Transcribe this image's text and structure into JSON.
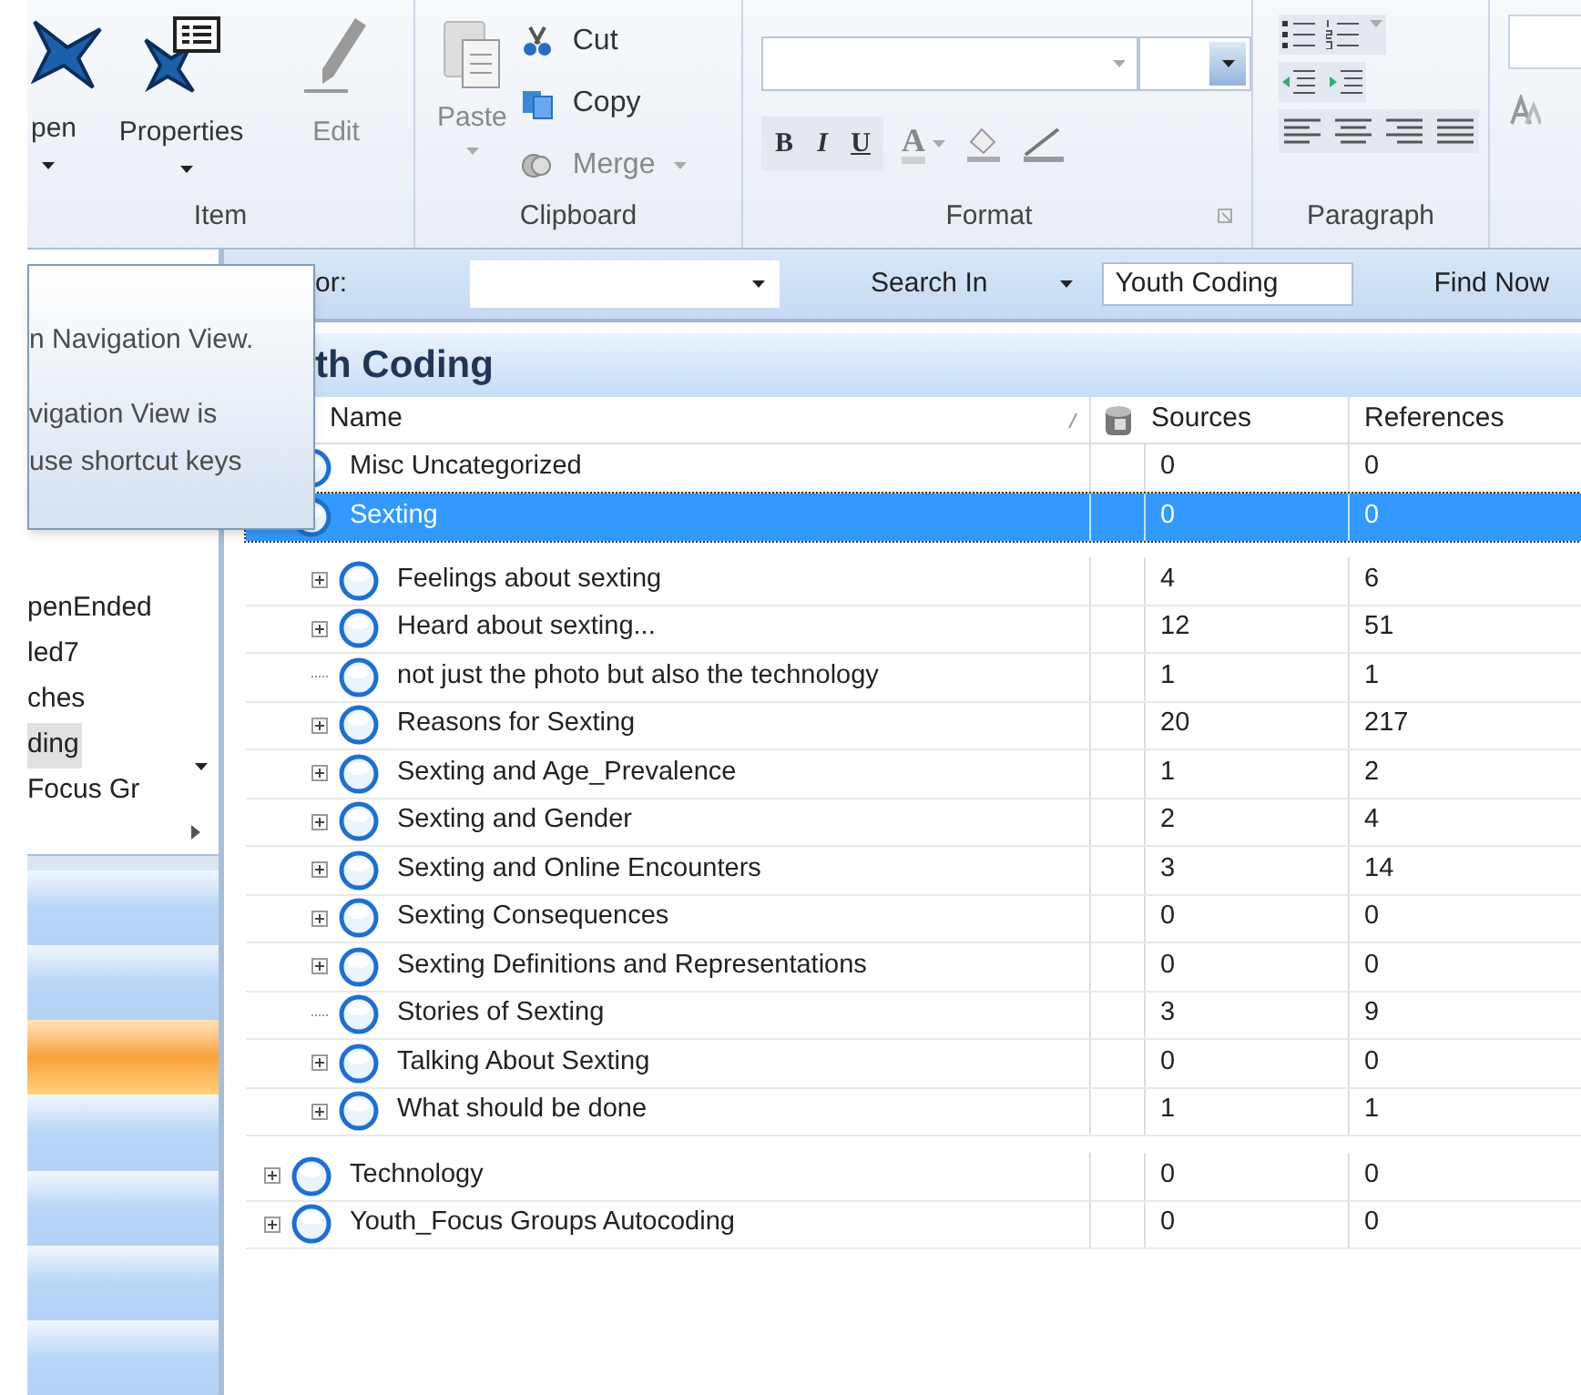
{
  "ribbon": {
    "item_group": {
      "label": "Item",
      "buttons": [
        {
          "label": "pen",
          "kind": "node",
          "dropdown": true,
          "disabled": false
        },
        {
          "label": "Properties",
          "kind": "properties",
          "dropdown": true,
          "disabled": false
        },
        {
          "label": "Edit",
          "kind": "pencil",
          "dropdown": false,
          "disabled": true
        }
      ]
    },
    "clipboard_group": {
      "label": "Clipboard",
      "paste": {
        "label": "Paste",
        "disabled": true
      },
      "small": [
        {
          "label": "Cut",
          "kind": "cut",
          "disabled": false,
          "dropdown": false
        },
        {
          "label": "Copy",
          "kind": "copy",
          "disabled": false,
          "dropdown": false
        },
        {
          "label": "Merge",
          "kind": "merge",
          "disabled": true,
          "dropdown": true
        }
      ]
    },
    "format_group": {
      "label": "Format",
      "style_buttons": [
        {
          "label": "B",
          "kind": "bold"
        },
        {
          "label": "I",
          "kind": "italic"
        },
        {
          "label": "U",
          "kind": "underline"
        },
        {
          "label": "A",
          "kind": "color"
        }
      ]
    },
    "paragraph_group": {
      "label": "Paragraph"
    }
  },
  "search_bar": {
    "label": "or:",
    "search_in": "Search In",
    "scope": "Youth Coding",
    "find_now": "Find Now"
  },
  "navigation": {
    "items": [
      {
        "label": "penEnded",
        "selected": false
      },
      {
        "label": "led7",
        "selected": false
      },
      {
        "label": "ches",
        "selected": false
      },
      {
        "label": "ding",
        "selected": true
      },
      {
        "label": "Focus Gr",
        "selected": false
      }
    ],
    "nav_buttons": [
      {
        "selected": false
      },
      {
        "selected": false
      },
      {
        "selected": true
      },
      {
        "selected": false
      },
      {
        "selected": false
      },
      {
        "selected": false
      },
      {
        "selected": false
      }
    ]
  },
  "tooltip": {
    "lines": [
      "n Navigation View.",
      "vigation View is",
      "use shortcut keys"
    ]
  },
  "panel": {
    "title": "th Coding",
    "columns": {
      "name": "Name",
      "sources": "Sources",
      "references": "References"
    },
    "nodes": [
      {
        "name": "Misc Uncategorized",
        "sources": "0",
        "references": "0",
        "expandable": false,
        "selected": false
      },
      {
        "name": "Sexting",
        "sources": "0",
        "references": "0",
        "expandable": true,
        "selected": true,
        "children": [
          {
            "name": "Feelings about sexting",
            "sources": "4",
            "references": "6",
            "expandable": true,
            "selected": false
          },
          {
            "name": "Heard about sexting...",
            "sources": "12",
            "references": "51",
            "expandable": true,
            "selected": false
          },
          {
            "name": "not just the photo but also the technology",
            "sources": "1",
            "references": "1",
            "expandable": false,
            "selected": false
          },
          {
            "name": "Reasons for Sexting",
            "sources": "20",
            "references": "217",
            "expandable": true,
            "selected": false
          },
          {
            "name": "Sexting and Age_Prevalence",
            "sources": "1",
            "references": "2",
            "expandable": true,
            "selected": false
          },
          {
            "name": "Sexting and Gender",
            "sources": "2",
            "references": "4",
            "expandable": true,
            "selected": false
          },
          {
            "name": "Sexting and Online Encounters",
            "sources": "3",
            "references": "14",
            "expandable": true,
            "selected": false
          },
          {
            "name": "Sexting Consequences",
            "sources": "0",
            "references": "0",
            "expandable": true,
            "selected": false
          },
          {
            "name": "Sexting Definitions and Representations",
            "sources": "0",
            "references": "0",
            "expandable": true,
            "selected": false
          },
          {
            "name": "Stories of Sexting",
            "sources": "3",
            "references": "9",
            "expandable": false,
            "selected": false
          },
          {
            "name": "Talking About Sexting",
            "sources": "0",
            "references": "0",
            "expandable": true,
            "selected": false
          },
          {
            "name": "What should be done",
            "sources": "1",
            "references": "1",
            "expandable": true,
            "selected": false
          }
        ]
      },
      {
        "name": "Technology",
        "sources": "0",
        "references": "0",
        "expandable": true,
        "selected": false
      },
      {
        "name": "Youth_Focus Groups Autocoding",
        "sources": "0",
        "references": "0",
        "expandable": true,
        "selected": false
      }
    ]
  }
}
